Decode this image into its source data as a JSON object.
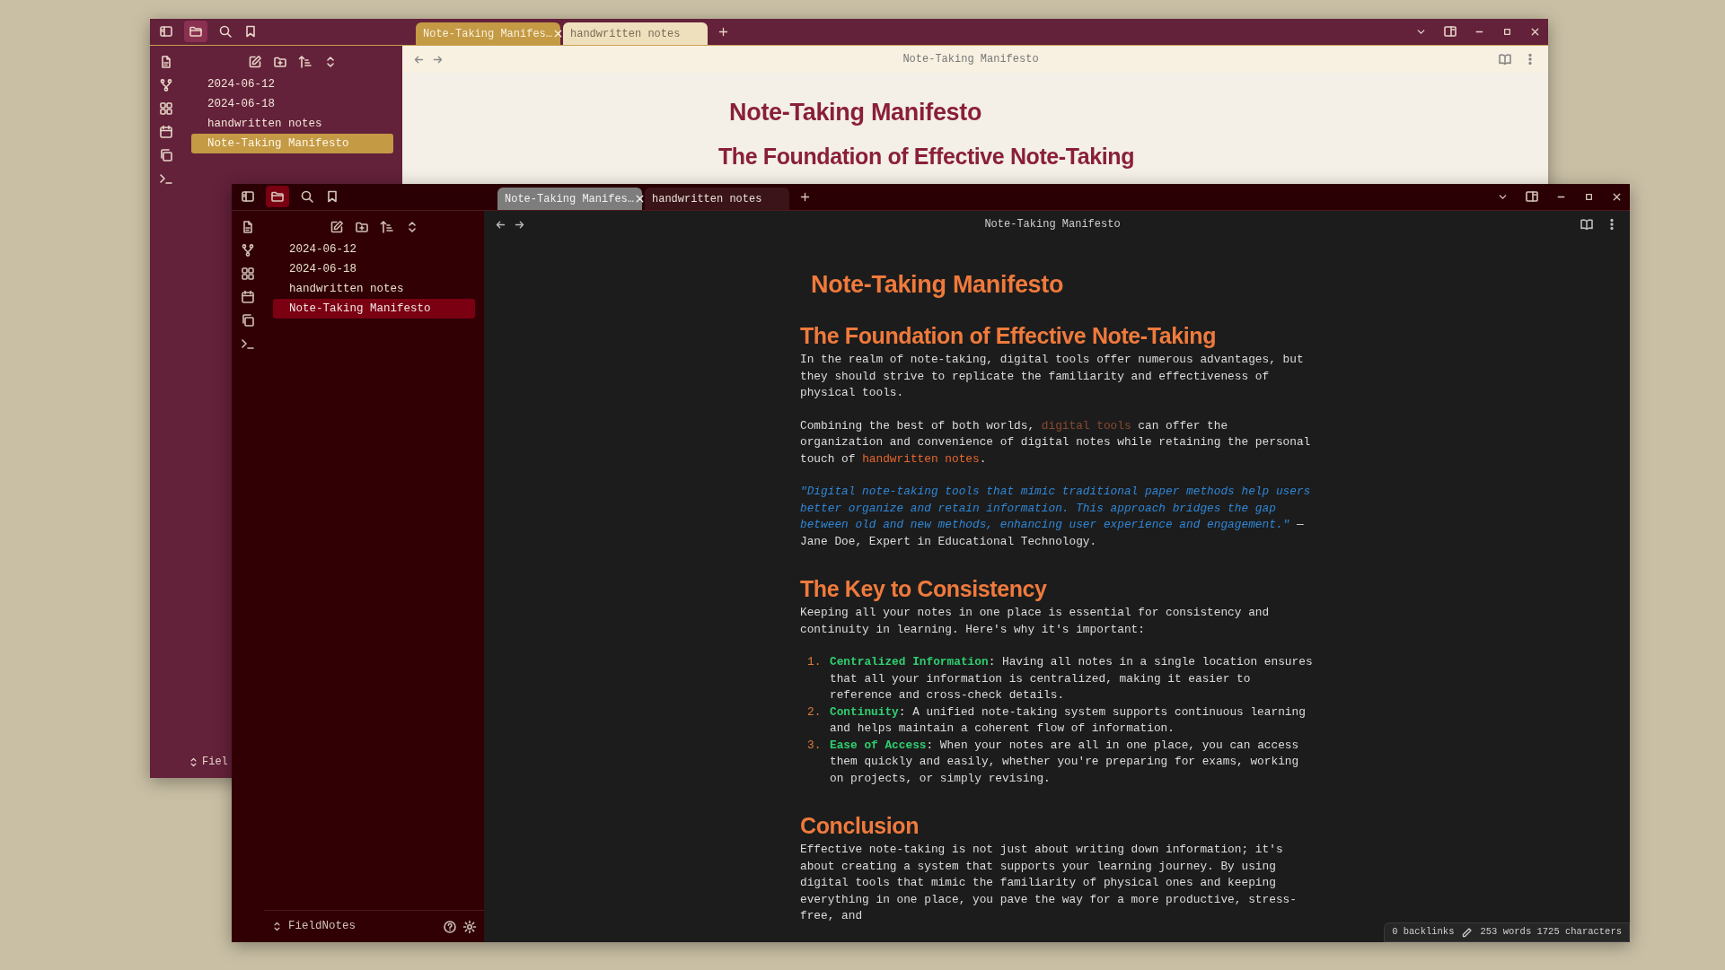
{
  "back_window": {
    "tabs": [
      {
        "label": "Note-Taking Manifes…",
        "selected": true
      },
      {
        "label": "handwritten notes",
        "selected": false
      }
    ],
    "files": [
      {
        "label": "2024-06-12",
        "selected": false
      },
      {
        "label": "2024-06-18",
        "selected": false
      },
      {
        "label": "handwritten notes",
        "selected": false
      },
      {
        "label": "Note-Taking Manifesto",
        "selected": true
      }
    ],
    "vault_name": "Fiel",
    "view_title": "Note-Taking Manifesto",
    "document": [
      {
        "kind": "h1",
        "text": "Note-Taking Manifesto"
      },
      {
        "kind": "h2",
        "text": "The Foundation of Effective Note-Taking"
      }
    ]
  },
  "front_window": {
    "tabs": [
      {
        "label": "Note-Taking Manifes…",
        "selected": true
      },
      {
        "label": "handwritten notes",
        "selected": false
      }
    ],
    "files": [
      {
        "label": "2024-06-12",
        "selected": false
      },
      {
        "label": "2024-06-18",
        "selected": false
      },
      {
        "label": "handwritten notes",
        "selected": false
      },
      {
        "label": "Note-Taking Manifesto",
        "selected": true
      }
    ],
    "vault_name": "FieldNotes",
    "view_title": "Note-Taking Manifesto",
    "document": [
      {
        "kind": "h1",
        "text": "Note-Taking Manifesto"
      },
      {
        "kind": "h2",
        "text": "The Foundation of Effective Note-Taking"
      },
      {
        "kind": "p",
        "parts": [
          {
            "kind": "text",
            "text": "In the realm of note-taking, digital tools offer numerous advantages, but they should strive to replicate the familiarity and effectiveness of physical tools."
          }
        ]
      },
      {
        "kind": "p",
        "parts": [
          {
            "kind": "text",
            "text": "Combining the best of both worlds, "
          },
          {
            "kind": "unresolved-link",
            "text": "digital tools"
          },
          {
            "kind": "text",
            "text": " can offer the organization and convenience of digital notes while retaining the personal touch of "
          },
          {
            "kind": "link",
            "text": "handwritten notes"
          },
          {
            "kind": "text",
            "text": "."
          }
        ]
      },
      {
        "kind": "p",
        "parts": [
          {
            "kind": "quote",
            "text": "\"Digital note-taking tools that mimic traditional paper methods help users better organize and retain information. This approach bridges the gap between old and new methods, enhancing user experience and engagement.\""
          },
          {
            "kind": "text",
            "text": " — Jane Doe, Expert in Educational Technology."
          }
        ]
      },
      {
        "kind": "h2",
        "text": "The Key to Consistency"
      },
      {
        "kind": "p",
        "parts": [
          {
            "kind": "text",
            "text": "Keeping all your notes in one place is essential for consistency and continuity in learning. Here's why it's important:"
          }
        ]
      },
      {
        "kind": "ol",
        "items": [
          {
            "number": "1.",
            "term": "Centralized Information",
            "text": ": Having all notes in a single location ensures that all your information is centralized, making it easier to reference and cross-check details."
          },
          {
            "number": "2.",
            "term": "Continuity",
            "text": ": A unified note-taking system supports continuous learning and helps maintain a coherent flow of information."
          },
          {
            "number": "3.",
            "term": "Ease of Access",
            "text": ": When your notes are all in one place, you can access them quickly and easily, whether you're preparing for exams, working on projects, or simply revising."
          }
        ]
      },
      {
        "kind": "h2",
        "text": "Conclusion"
      },
      {
        "kind": "p",
        "parts": [
          {
            "kind": "text",
            "text": "Effective note-taking is not just about writing down information; it's about creating a system that supports your learning journey. By using digital tools that mimic the familiarity of physical ones and keeping everything in one place, you pave the way for a more productive, stress-free, and"
          }
        ]
      }
    ],
    "status_bar": {
      "backlinks": "0 backlinks",
      "counts": "253 words 1725 characters"
    }
  }
}
